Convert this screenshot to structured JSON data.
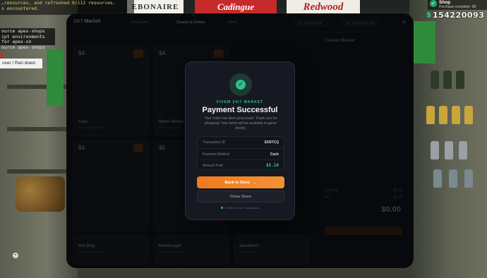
{
  "console": {
    "top_line1": "…resources, and refreshed 0/112 resources.",
    "top_line2": "s encountered.",
    "mid_line1": "ource apex-shops",
    "mid_line2": "ipt environments for apex-sh",
    "mid_line3": "ource apex-shops",
    "ran_down": "over / Ran down"
  },
  "background": {
    "banner_a": "EBONAIRE",
    "banner_b": "Cadingue",
    "banner_c": "Redwood"
  },
  "notification": {
    "title": "Shop",
    "subtitle": "Purchase complete! -$5",
    "icon": "check-icon"
  },
  "hud": {
    "money_sign": "$",
    "money_value": "154220093"
  },
  "market": {
    "logo_prefix": "24/7",
    "logo_name": "Market",
    "tabs": [
      "Groceries",
      "Snacks & Drinks",
      "Other"
    ],
    "stats": [
      "$3,600 $3,600",
      "$5,100 $130,000"
    ],
    "close_icon": "close-icon",
    "cards": [
      {
        "price": "$4",
        "name": "Cola",
        "desc": "Refreshing cold drink"
      },
      {
        "price": "$4",
        "name": "Water Bottle",
        "desc": "Pure spring water"
      },
      {
        "price": "$4",
        "name": "",
        "desc": ""
      },
      {
        "price": "$5",
        "name": "",
        "desc": ""
      },
      {
        "price": "$4",
        "name": "Hot Dog",
        "desc": "Fresh grilled sausage"
      },
      {
        "price": "$4",
        "name": "Hamburger",
        "desc": "Classic beef burger"
      },
      {
        "price": "$4",
        "name": "Sandwich",
        "desc": "Freshly made"
      }
    ],
    "basket": {
      "title": "Current Basket",
      "rows": [
        {
          "label": "Subtotal",
          "value": "$0.00"
        },
        {
          "label": "Tax",
          "value": "$0.00"
        }
      ],
      "total": "$0.00"
    }
  },
  "modal": {
    "brand": "FIVEM 24/7 MARKET",
    "title": "Payment Successful",
    "message": "Your order has been processed. Thank you for shopping! Your items will be available in-game shortly.",
    "details": [
      {
        "label": "Transaction ID",
        "value": "E5NTCQ"
      },
      {
        "label": "Payment Method",
        "value": "Cash"
      },
      {
        "label": "Amount Paid",
        "value": "$5.10"
      }
    ],
    "back_button": "Back to Store",
    "close_button": "Close Store",
    "verified": "Verified Secure Transaction",
    "colors": {
      "accent": "#f07a1e",
      "success": "#35c08d"
    }
  }
}
